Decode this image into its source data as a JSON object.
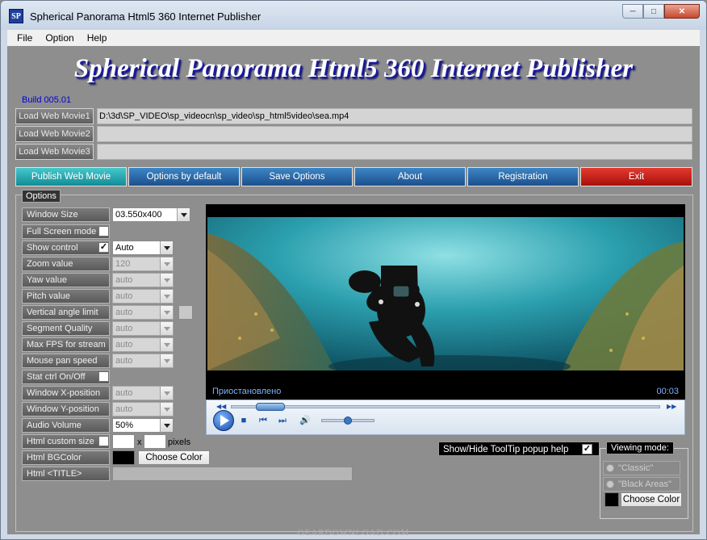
{
  "window": {
    "title": "Spherical Panorama Html5 360 Internet Publisher",
    "icon_text": "SP"
  },
  "menu": [
    "File",
    "Option",
    "Help"
  ],
  "hero_title": "Spherical Panorama Html5 360 Internet Publisher",
  "build": "Build 005.01",
  "load": [
    {
      "label": "Load Web Movie1",
      "path": "D:\\3d\\SP_VIDEO\\sp_videocn\\sp_video\\sp_html5video\\sea.mp4"
    },
    {
      "label": "Load Web Movie2",
      "path": ""
    },
    {
      "label": "Load Web Movie3",
      "path": ""
    }
  ],
  "main_buttons": [
    {
      "label": "Publish Web Movie"
    },
    {
      "label": "Options by default"
    },
    {
      "label": "Save Options"
    },
    {
      "label": "About"
    },
    {
      "label": "Registration"
    },
    {
      "label": "Exit"
    }
  ],
  "options": {
    "legend": "Options",
    "window_size": {
      "label": "Window Size",
      "value": "03.550x400"
    },
    "full_screen": {
      "label": "Full Screen mode",
      "checked": false
    },
    "show_control": {
      "label": "Show control",
      "checked": true,
      "value": "Auto"
    },
    "zoom": {
      "label": "Zoom value",
      "value": "120"
    },
    "yaw": {
      "label": "Yaw value",
      "value": "auto"
    },
    "pitch": {
      "label": "Pitch value",
      "value": "auto"
    },
    "vertical_angle": {
      "label": "Vertical angle limit",
      "value": "auto"
    },
    "segment_quality": {
      "label": "Segment Quality",
      "value": "auto"
    },
    "max_fps": {
      "label": "Max FPS for stream",
      "value": "auto"
    },
    "mouse_pan": {
      "label": "Mouse pan speed",
      "value": "auto"
    },
    "stat_ctrl": {
      "label": "Stat ctrl On/Off",
      "checked": false
    },
    "window_x": {
      "label": "Window X-position",
      "value": "auto"
    },
    "window_y": {
      "label": "Window Y-position",
      "value": "auto"
    },
    "audio_volume": {
      "label": "Audio Volume",
      "value": "50%"
    },
    "custom_size": {
      "label": "Html custom size",
      "times": "x",
      "unit": "pixels"
    },
    "bgcolor": {
      "label": "Html BGColor",
      "button": "Choose Color",
      "color": "#000000"
    },
    "html_title": {
      "label": "Html <TITLE>",
      "value": ""
    }
  },
  "player": {
    "status": "Приостановлено",
    "time": "00:03",
    "progress_fraction": 0.06,
    "volume_fraction": 0.5
  },
  "tooltip_toggle": {
    "label": "Show/Hide ToolTip popup help",
    "checked": true
  },
  "viewing_mode": {
    "legend": "Viewing mode:",
    "options": [
      "\"Classic\"",
      "\"Black Areas\""
    ],
    "button": "Choose Color",
    "color": "#000000"
  },
  "watermark": "GEARDOWNLOAD.COM",
  "colors": {
    "publish": "#1c9aa3",
    "main": "#2166ab",
    "exit": "#c01812"
  }
}
